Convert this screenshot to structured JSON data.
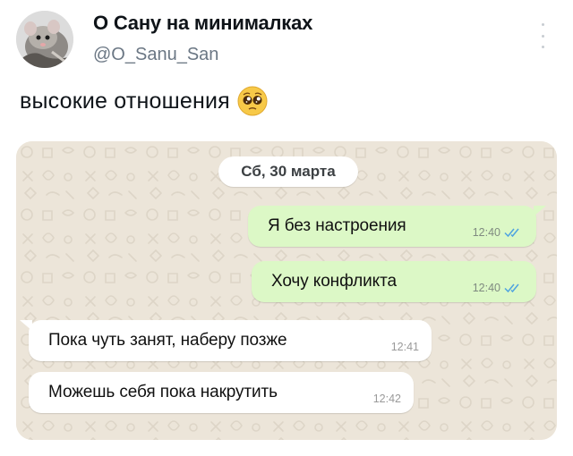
{
  "tweet": {
    "author_name": "О Сану на минималках",
    "author_handle": "@O_Sanu_San",
    "text": "высокие отношения",
    "text_emoji": "pleading-face-emoji"
  },
  "chat": {
    "date_label": "Сб, 30 марта",
    "messages": [
      {
        "direction": "outgoing",
        "text": "Я без настроения",
        "time": "12:40",
        "status": "read-double-check"
      },
      {
        "direction": "outgoing",
        "text": "Хочу конфликта",
        "time": "12:40",
        "status": "read-double-check"
      },
      {
        "direction": "incoming",
        "text": "Пока чуть занят, наберу позже",
        "time": "12:41"
      },
      {
        "direction": "incoming",
        "text": "Можешь себя пока накрутить",
        "time": "12:42"
      }
    ]
  },
  "colors": {
    "outgoing_bubble": "#dcf8c6",
    "incoming_bubble": "#ffffff",
    "chat_background": "#ede7dc",
    "read_ticks": "#4fa3e0"
  }
}
